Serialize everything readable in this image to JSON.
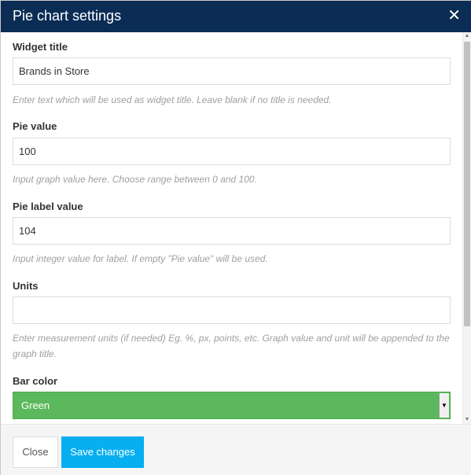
{
  "dialog": {
    "title": "Pie chart settings",
    "close_icon": "close-icon",
    "close_glyph": "✕",
    "header_color": "#0b2d55"
  },
  "fields": {
    "widget_title": {
      "label": "Widget title",
      "value": "Brands in Store",
      "help": "Enter text which will be used as widget title. Leave blank if no title is needed."
    },
    "pie_value": {
      "label": "Pie value",
      "value": "100",
      "help": "Input graph value here. Choose range between 0 and 100."
    },
    "pie_label_value": {
      "label": "Pie label value",
      "value": "104",
      "help": "Input integer value for label. If empty \"Pie value\" will be used."
    },
    "units": {
      "label": "Units",
      "value": "",
      "help": "Enter measurement units (if needed) Eg. %, px, points, etc. Graph value and unit will be appended to the graph title."
    },
    "bar_color": {
      "label": "Bar color",
      "selected": "Green",
      "color": "#5cb85c"
    }
  },
  "footer": {
    "close_label": "Close",
    "save_label": "Save changes",
    "save_color": "#07aef0"
  }
}
